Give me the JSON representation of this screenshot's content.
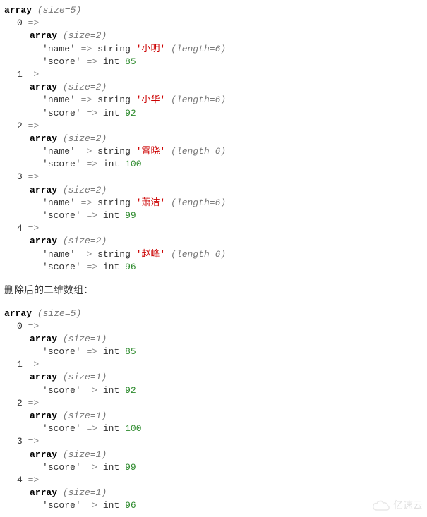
{
  "labels": {
    "array": "array",
    "size_open": "(size=",
    "size_close": ")",
    "arrow": "=>",
    "string": "string",
    "int": "int",
    "length_open": "(length=",
    "length_close": ")"
  },
  "section_label": "删除后的二维数组：",
  "watermark_text": "亿速云",
  "dump1": {
    "size": "5",
    "items": [
      {
        "idx": "0",
        "size": "2",
        "name_key": "name",
        "name_val": "小明",
        "len": "6",
        "score_key": "score",
        "score_val": "85"
      },
      {
        "idx": "1",
        "size": "2",
        "name_key": "name",
        "name_val": "小华",
        "len": "6",
        "score_key": "score",
        "score_val": "92"
      },
      {
        "idx": "2",
        "size": "2",
        "name_key": "name",
        "name_val": "霄晓",
        "len": "6",
        "score_key": "score",
        "score_val": "100"
      },
      {
        "idx": "3",
        "size": "2",
        "name_key": "name",
        "name_val": "萧洁",
        "len": "6",
        "score_key": "score",
        "score_val": "99"
      },
      {
        "idx": "4",
        "size": "2",
        "name_key": "name",
        "name_val": "赵峰",
        "len": "6",
        "score_key": "score",
        "score_val": "96"
      }
    ]
  },
  "dump2": {
    "size": "5",
    "items": [
      {
        "idx": "0",
        "size": "1",
        "score_key": "score",
        "score_val": "85"
      },
      {
        "idx": "1",
        "size": "1",
        "score_key": "score",
        "score_val": "92"
      },
      {
        "idx": "2",
        "size": "1",
        "score_key": "score",
        "score_val": "100"
      },
      {
        "idx": "3",
        "size": "1",
        "score_key": "score",
        "score_val": "99"
      },
      {
        "idx": "4",
        "size": "1",
        "score_key": "score",
        "score_val": "96"
      }
    ]
  }
}
